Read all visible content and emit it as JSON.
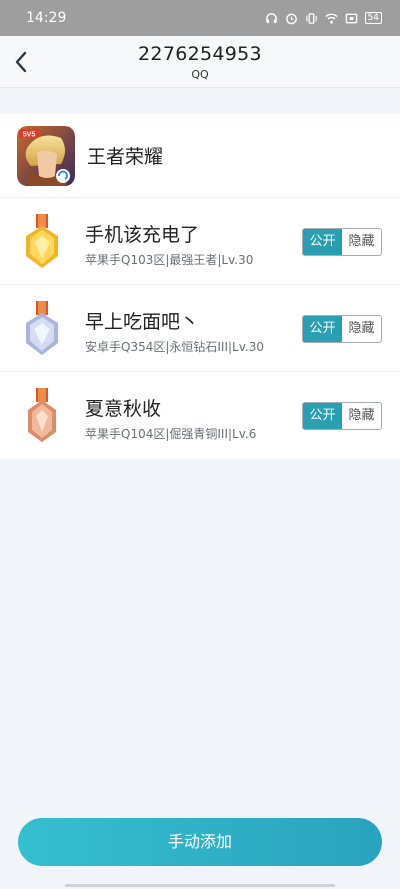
{
  "status_bar": {
    "time": "14:29",
    "icons": [
      "headphones-icon",
      "alarm-icon",
      "vibrate-icon",
      "wifi-icon",
      "screen-icon"
    ],
    "battery": "54"
  },
  "header": {
    "title": "2276254953",
    "subtitle": "QQ",
    "back_icon": "chevron-left-icon"
  },
  "game": {
    "name": "王者荣耀",
    "icon": "game-logo-icon"
  },
  "roles": [
    {
      "name": "手机该充电了",
      "detail": "苹果手Q103区|最强王者|Lv.30",
      "medal": "gold",
      "public_label": "公开",
      "hide_label": "隐藏",
      "public": true
    },
    {
      "name": "早上吃面吧丶",
      "detail": "安卓手Q354区|永恒钻石III|Lv.30",
      "medal": "diamond",
      "public_label": "公开",
      "hide_label": "隐藏",
      "public": true
    },
    {
      "name": "夏意秋收",
      "detail": "苹果手Q104区|倔强青铜III|Lv.6",
      "medal": "bronze",
      "public_label": "公开",
      "hide_label": "隐藏",
      "public": true
    }
  ],
  "add_button": {
    "label": "手动添加"
  },
  "colors": {
    "accent": "#2b9fb2",
    "button_gradient_start": "#35bfcf",
    "button_gradient_end": "#2aa3bd",
    "page_background": "#f1f4f8"
  }
}
